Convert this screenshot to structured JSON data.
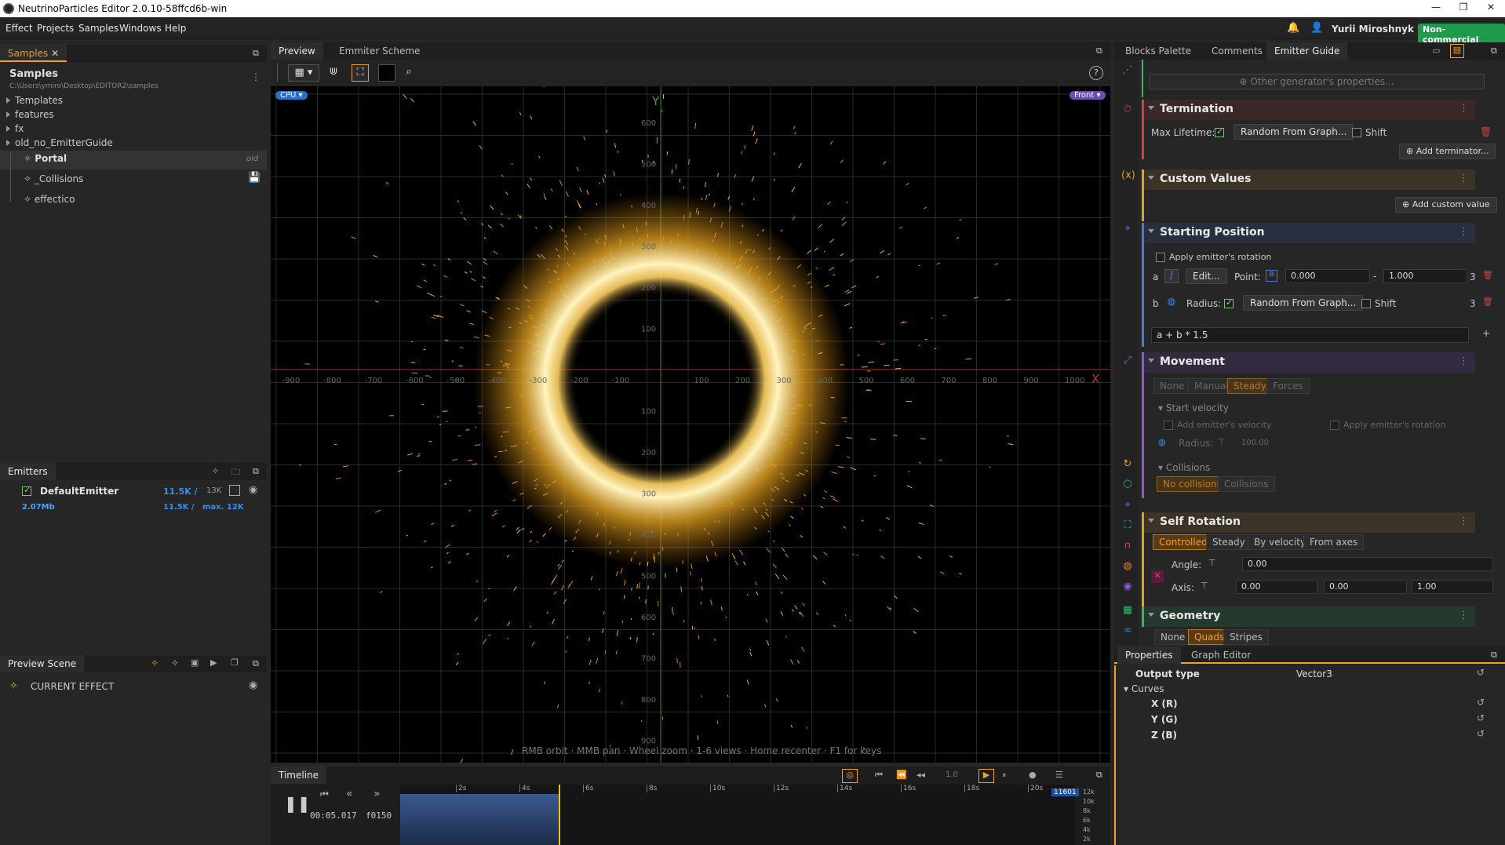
{
  "window": {
    "title": "NeutrinoParticles Editor 2.0.10-58ffcd6b-win"
  },
  "menu": [
    "Effect",
    "Projects",
    "Samples",
    "Windows",
    "Help"
  ],
  "user": {
    "name": "Yurii Miroshnyk",
    "license": "Non-commercial"
  },
  "samples_panel": {
    "tab": "Samples",
    "title": "Samples",
    "path": "C:\\Users\\ymiro\\Desktop\\EDITOR2\\samples",
    "folders": [
      "Templates",
      "features",
      "fx",
      "old_no_EmitterGuide"
    ],
    "effects": [
      {
        "name": "Portal",
        "tag": "old"
      },
      {
        "name": "_Collisions",
        "tag": ""
      },
      {
        "name": "effectico",
        "tag": ""
      }
    ]
  },
  "emitters_panel": {
    "tab": "Emitters",
    "emitter": {
      "name": "DefaultEmitter",
      "count": "11.5K /",
      "max": "13K",
      "memory": "2.07Mb",
      "count2": "11.5K /",
      "max2": "max. 12K"
    }
  },
  "preview_scene": {
    "tab": "Preview Scene",
    "item": "CURRENT EFFECT"
  },
  "viewport": {
    "tabs": [
      "Preview",
      "Emmiter Scheme"
    ],
    "cpu_badge": "CPU",
    "view_badge": "Front",
    "axis_y": "Y",
    "axis_x": "X",
    "x_ticks": [
      "-900",
      "-800",
      "-700",
      "-600",
      "-500",
      "-400",
      "-300",
      "-200",
      "-100",
      "100",
      "200",
      "300",
      "400",
      "500",
      "600",
      "700",
      "800",
      "900",
      "1000"
    ],
    "y_ticks_pos": [
      "600",
      "500",
      "400",
      "300",
      "200",
      "100"
    ],
    "y_ticks_neg": [
      "100",
      "200",
      "300",
      "400",
      "500",
      "600",
      "700",
      "800",
      "900"
    ],
    "hint": "RMB orbit · MMB pan · Wheel zoom · 1-6 views · Home recenter · F1 for keys"
  },
  "timeline": {
    "tab": "Timeline",
    "time": "00:05.017",
    "frame": "f0150",
    "speed": "1.0",
    "marks": [
      "2s",
      "4s",
      "6s",
      "8s",
      "10s",
      "12s",
      "14s",
      "16s",
      "18s",
      "20s"
    ],
    "counter": "11601",
    "y_ticks": [
      "12k",
      "10k",
      "8k",
      "6k",
      "4k",
      "2k"
    ]
  },
  "right_tabs": [
    "Blocks Palette",
    "Comments",
    "Emitter Guide"
  ],
  "guide": {
    "other_props": "Other generator's properties...",
    "termination": {
      "title": "Termination",
      "max_lifetime": "Max Lifetime:",
      "mode": "Random From Graph...",
      "shift": "Shift",
      "add": "Add terminator..."
    },
    "custom_values": {
      "title": "Custom Values",
      "add": "Add custom value"
    },
    "starting_position": {
      "title": "Starting Position",
      "apply_rotation": "Apply emitter's rotation",
      "a_label": "a",
      "edit": "Edit...",
      "point": "Point:",
      "p1": "0.000",
      "sep": "-",
      "p2": "1.000",
      "a_count": "3",
      "b_label": "b",
      "radius": "Radius:",
      "b_mode": "Random From Graph...",
      "shift": "Shift",
      "b_count": "3",
      "expr": "a + b * 1.5",
      "plus": "+"
    },
    "movement": {
      "title": "Movement",
      "modes": [
        "None",
        "Manual",
        "Steady",
        "Forces"
      ],
      "start_velocity": "Start velocity",
      "add_velocity": "Add emitter's velocity",
      "apply_rotation": "Apply emitter's rotation",
      "radius": "Radius:",
      "radius_value": "100.00",
      "collisions": "Collisions",
      "col_modes": [
        "No collisions",
        "Collisions"
      ]
    },
    "self_rotation": {
      "title": "Self Rotation",
      "modes": [
        "Controlled",
        "Steady",
        "By velocity",
        "From axes"
      ],
      "angle": "Angle:",
      "angle_value": "0.00",
      "axis": "Axis:",
      "axis_values": [
        "0.00",
        "0.00",
        "1.00"
      ]
    },
    "geometry": {
      "title": "Geometry",
      "modes": [
        "None",
        "Quads",
        "Stripes"
      ]
    }
  },
  "bottom_right": {
    "tabs": [
      "Properties",
      "Graph Editor"
    ],
    "output_type_label": "Output type",
    "output_type_value": "Vector3",
    "curves": "Curves",
    "channels": [
      "X (R)",
      "Y (G)",
      "Z (B)"
    ]
  },
  "colors": {
    "accent": "#f0a030",
    "brand": "#1f9a4a",
    "bg": "#262626",
    "link": "#3a8ee6"
  }
}
